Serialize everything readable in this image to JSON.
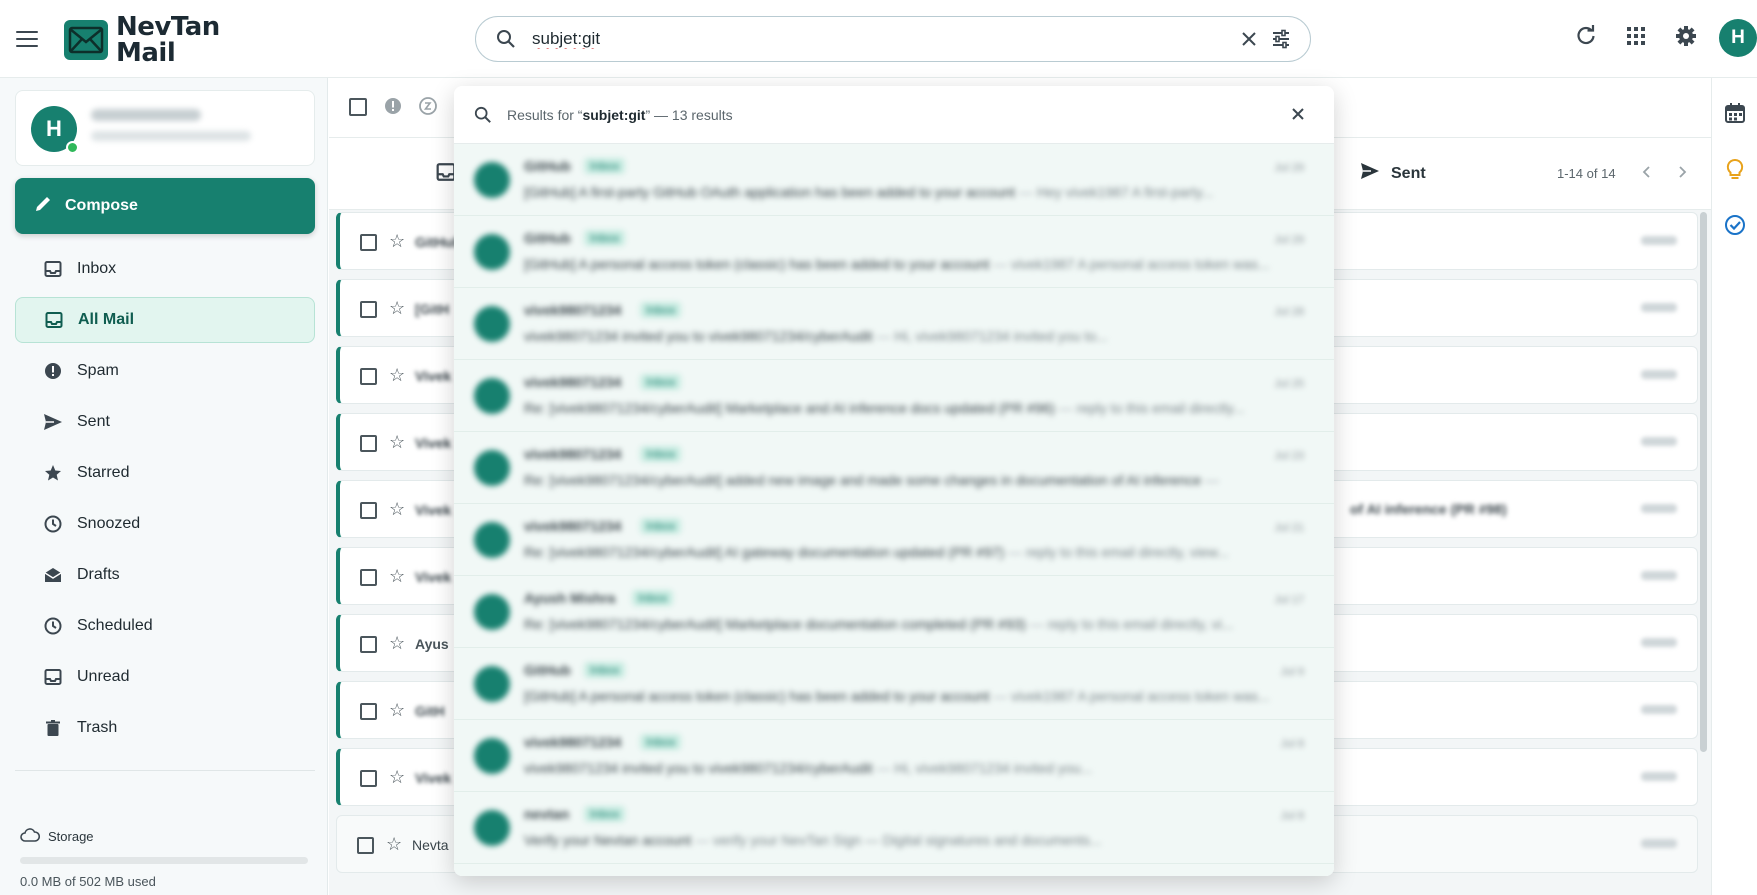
{
  "app": {
    "brand_line1": "NevTan",
    "brand_line2": "Mail"
  },
  "search": {
    "query": "subjet:git"
  },
  "account": {
    "initial": "H",
    "name": "Harsh Saxena",
    "email": "harsh@nevtanlabs.com"
  },
  "compose_label": "Compose",
  "nav": {
    "items": [
      {
        "label": "Inbox",
        "icon": "inbox-icon"
      },
      {
        "label": "All Mail",
        "icon": "all-mail-icon"
      },
      {
        "label": "Spam",
        "icon": "spam-icon"
      },
      {
        "label": "Sent",
        "icon": "sent-icon"
      },
      {
        "label": "Starred",
        "icon": "star-icon"
      },
      {
        "label": "Snoozed",
        "icon": "clock-icon"
      },
      {
        "label": "Drafts",
        "icon": "drafts-icon"
      },
      {
        "label": "Scheduled",
        "icon": "scheduled-icon"
      },
      {
        "label": "Unread",
        "icon": "unread-icon"
      },
      {
        "label": "Trash",
        "icon": "trash-icon"
      }
    ],
    "active_index": 1
  },
  "storage": {
    "label": "Storage",
    "used_text": "0.0 MB of 502 MB used",
    "fraction": 0.0
  },
  "list_header": {
    "tab_label": "Sent",
    "pager_text": "1-14 of 14"
  },
  "list_rows": [
    {
      "sender": "GitHub",
      "clear": false,
      "extra": ""
    },
    {
      "sender": "[GitH",
      "clear": false,
      "extra": ""
    },
    {
      "sender": "Vivek",
      "clear": false,
      "extra": ""
    },
    {
      "sender": "Vivek",
      "clear": false,
      "extra": ""
    },
    {
      "sender": "Vivek",
      "clear": false,
      "extra": "of AI inference (PR #98)"
    },
    {
      "sender": "Vivek",
      "clear": false,
      "extra": ""
    },
    {
      "sender": "Ayus",
      "clear": true,
      "extra": ""
    },
    {
      "sender": "GitH",
      "clear": false,
      "extra": ""
    },
    {
      "sender": "Vivek",
      "clear": false,
      "extra": ""
    },
    {
      "sender": "Nevta",
      "clear": true,
      "extra": ""
    }
  ],
  "dropdown": {
    "prefix": "Results for “",
    "query": "subjet:git",
    "suffix": "” — 13 results",
    "items": [
      {
        "from": "GitHub",
        "tag": "Inbox",
        "subject": "[GitHub] A first-party GitHub OAuth application has been added to your account",
        "snippet": "Hey vivek1987 A first-party...",
        "date": "Jul 29"
      },
      {
        "from": "GitHub",
        "tag": "Inbox",
        "subject": "[GitHub] A personal access token (classic) has been added to your account",
        "snippet": "vivek1987 A personal access token was...",
        "date": "Jul 29"
      },
      {
        "from": "vivek98071234",
        "tag": "Inbox",
        "subject": "vivek98071234 invited you to vivek98071234/cyberAudit",
        "snippet": "Hi, vivek98071234 invited you to...",
        "date": "Jul 28"
      },
      {
        "from": "vivek98071234",
        "tag": "Inbox",
        "subject": "Re: [vivek98071234/cyberAudit] Marketplace and AI inference docs updated (PR #96)",
        "snippet": "reply to this email directly...",
        "date": "Jul 25"
      },
      {
        "from": "vivek98071234",
        "tag": "Inbox",
        "subject": "Re: [vivek98071234/cyberAudit] added new image and made some changes in documentation of AI inference",
        "snippet": "",
        "date": "Jul 23"
      },
      {
        "from": "vivek98071234",
        "tag": "Inbox",
        "subject": "Re: [vivek98071234/cyberAudit] AI gateway documentation updated (PR #97)",
        "snippet": "reply to this email directly, view...",
        "date": "Jul 21"
      },
      {
        "from": "Ayush Mishra",
        "tag": "Inbox",
        "subject": "Re: [vivek98071234/cyberAudit] Marketplace documentation completed (PR #93)",
        "snippet": "reply to this email directly, vi...",
        "date": "Jul 17"
      },
      {
        "from": "GitHub",
        "tag": "Inbox",
        "subject": "[GitHub] A personal access token (classic) has been added to your account",
        "snippet": "vivek1987 A personal access token was...",
        "date": "Jul 9"
      },
      {
        "from": "vivek98071234",
        "tag": "Inbox",
        "subject": "vivek98071234 invited you to vivek98071234/cyberAudit",
        "snippet": "Hi, vivek98071234 invited you...",
        "date": "Jul 8"
      },
      {
        "from": "nevtan",
        "tag": "Inbox",
        "subject": "Verify your Nevtan account",
        "snippet": "verify your NevTan Sign — Digital signatures and documents...",
        "date": "Jul 8"
      }
    ]
  },
  "colors": {
    "accent": "#17806f",
    "accent_light": "#e2f5ef",
    "online": "#2fb85a"
  }
}
